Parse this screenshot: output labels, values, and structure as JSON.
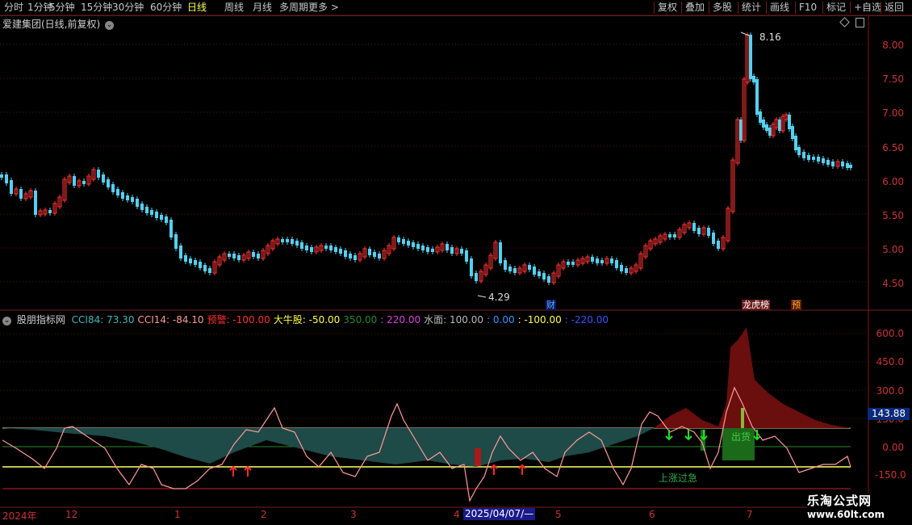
{
  "toolbar": {
    "left_items": [
      "分时",
      "1分钟",
      "5分钟",
      "15分钟",
      "30分钟",
      "60分钟",
      "日线",
      "周线",
      "月线",
      "多周期",
      "更多 >"
    ],
    "active_item": "日线",
    "right_items": [
      "复权",
      "叠加",
      "多股",
      "统计",
      "画线",
      "F10",
      "标记",
      "+自选",
      "返回"
    ]
  },
  "main_chart": {
    "title": "爱建集团(日线,前复权)",
    "title_btn": "⌄",
    "high_label": "8.16",
    "low_label": "4.29",
    "y_ticks": [
      "8.00",
      "7.50",
      "7.00",
      "6.50",
      "6.00",
      "5.50",
      "5.00",
      "4.50"
    ],
    "markers": [
      {
        "text": "财",
        "color": "#5fa8ff",
        "bg": "#0a1a5a"
      },
      {
        "text": "龙虎榜",
        "color": "#ffffff",
        "bg": "#6a1a1a"
      },
      {
        "text": "预",
        "color": "#ffaa33",
        "bg": "#5a1a00"
      }
    ]
  },
  "indicator": {
    "name": "股朋指标网",
    "legend": [
      {
        "text": "CCI84: 73.30",
        "color": "#44b8b8"
      },
      {
        "text": "CCI14: -84.10",
        "color": "#ff9999"
      },
      {
        "text": "预警: -100.00",
        "color": "#ff3333"
      },
      {
        "text": "大牛股: -50.00",
        "color": "#ffff44"
      },
      {
        "text": "350.00",
        "color": "#2a8a2a"
      },
      {
        "text": ": 220.00",
        "color": "#dd44dd"
      },
      {
        "text": "水面: 100.00",
        "color": "#bbbbbb"
      },
      {
        "text": ": 0.00",
        "color": "#3399ff"
      },
      {
        "text": ": -100.00",
        "color": "#ffff44"
      },
      {
        "text": ": -220.00",
        "color": "#3355ff"
      }
    ],
    "y_ticks": [
      "600.0",
      "450.0",
      "300.0",
      "150.0",
      "0.00",
      "-150.0"
    ],
    "current_value": "143.88",
    "annotation_sell": "出货",
    "annotation_rise": "上涨过急"
  },
  "time_axis": {
    "labels": [
      "2024年",
      "12",
      "1",
      "2",
      "3",
      "4",
      "5",
      "6",
      "7"
    ],
    "selected_date": "2025/04/07/—"
  },
  "watermark": {
    "line1": "乐淘公式网",
    "line2": "www.60lt.com"
  },
  "colors": {
    "up": "#ff3333",
    "down": "#44c8e8",
    "grid": "#6a1a1a",
    "teal_fill": "#1e4a48",
    "red_fill": "#6a0e0e",
    "green_fill": "#1a6a1a"
  }
}
